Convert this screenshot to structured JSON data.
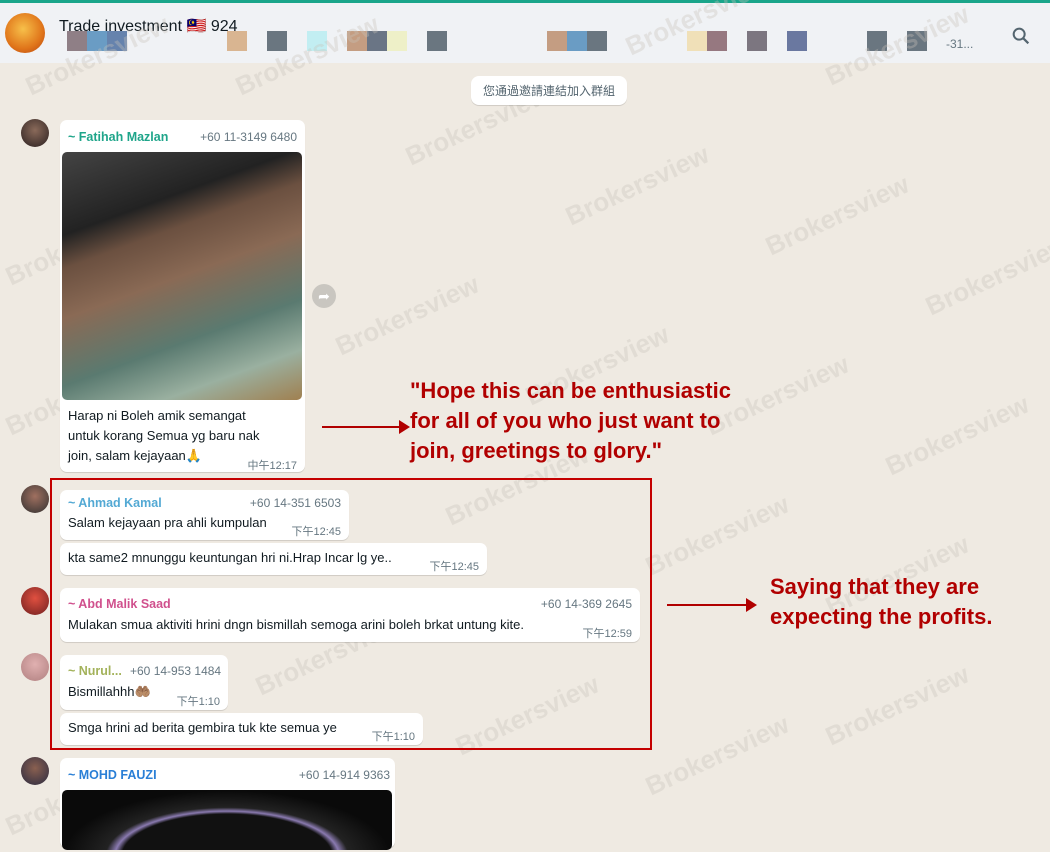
{
  "header": {
    "group_name": "Trade investment",
    "flag": "🇲🇾",
    "member_count": "924",
    "members_more": "-31...",
    "redaction_colors": [
      "#8f7f86",
      "#6a9cc4",
      "#6683ad",
      "#d9b591",
      "#6a7680",
      "#c2eef2",
      "#c49d82",
      "#6a7585",
      "#eef0c8",
      "#6a7680",
      "#c49d82",
      "#6a9cc4",
      "#6a7680",
      "#f0e0b8",
      "#967880",
      "#7c7680",
      "#6a78a0",
      "#6a7680",
      "#6a7680"
    ]
  },
  "system_message": "您通過邀請連結加入群組",
  "watermark": "Brokersview",
  "messages": [
    {
      "sender": "~ Fatihah Mazlan",
      "phone": "+60 11-3149 6480",
      "name_color": "#1fa58a",
      "lines": [
        "Harap ni Boleh amik semangat",
        "untuk korang Semua yg baru nak",
        "join, salam kejayaan🙏"
      ],
      "time": "中午12:17"
    },
    {
      "sender": "~ Ahmad Kamal",
      "phone": "+60 14-351 6503",
      "name_color": "#53a9d4",
      "text": "Salam kejayaan pra ahli kumpulan",
      "time": "下午12:45"
    },
    {
      "text": "kta same2 mnunggu keuntungan hri ni.Hrap Incar lg ye..",
      "time": "下午12:45"
    },
    {
      "sender": "~ Abd Malik Saad",
      "phone": "+60 14-369 2645",
      "name_color": "#d0508d",
      "text": "Mulakan smua aktiviti hrini dngn bismillah semoga arini boleh brkat untung kite.",
      "time": "下午12:59"
    },
    {
      "sender": "~ Nurul...",
      "phone": "+60 14-953 1484",
      "name_color": "#a3b25a",
      "text": "Bismillahhh🤲🏽",
      "time": "下午1:10"
    },
    {
      "text": "Smga hrini ad berita gembira tuk kte semua ye",
      "time": "下午1:10"
    },
    {
      "sender": "~ MOHD FAUZI",
      "phone": "+60 14-914 9363",
      "name_color": "#2a7fd6"
    }
  ],
  "annotations": {
    "first": [
      "\"Hope this can be enthusiastic",
      "for all of you who just want to",
      "join, greetings to glory.\""
    ],
    "second": [
      "Saying that they are",
      "expecting the profits."
    ]
  }
}
